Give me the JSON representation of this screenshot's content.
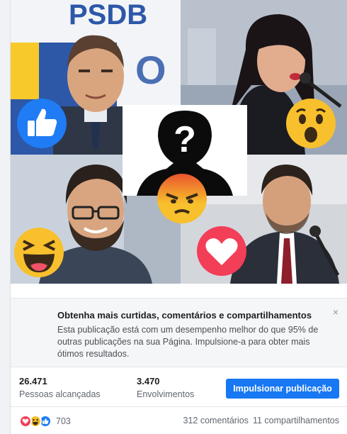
{
  "post": {
    "image": {
      "poster_text": "PSDB",
      "reactions_overlay": [
        "like-icon",
        "wow-icon",
        "angry-icon",
        "haha-icon",
        "love-icon"
      ]
    },
    "boost_tip": {
      "title": "Obtenha mais curtidas, comentários e compartilhamentos",
      "body": "Esta publicação está com um desempenho melhor do que 95% de outras publicações na sua Página. Impulsione-a para obter mais ótimos resultados.",
      "close_label": "×"
    },
    "stats": {
      "reach_value": "26.471",
      "reach_label": "Pessoas alcançadas",
      "engagement_value": "3.470",
      "engagement_label": "Envolvimentos",
      "boost_button": "Impulsionar publicação"
    },
    "footer": {
      "reaction_icons": [
        "love-icon",
        "haha-icon",
        "like-icon"
      ],
      "reaction_count": "703",
      "comments": "312 comentários",
      "shares": "11 compartilhamentos"
    }
  },
  "colors": {
    "accent": "#1877f2",
    "love": "#f33e58",
    "emoji_yellow": "#f7c02c"
  }
}
